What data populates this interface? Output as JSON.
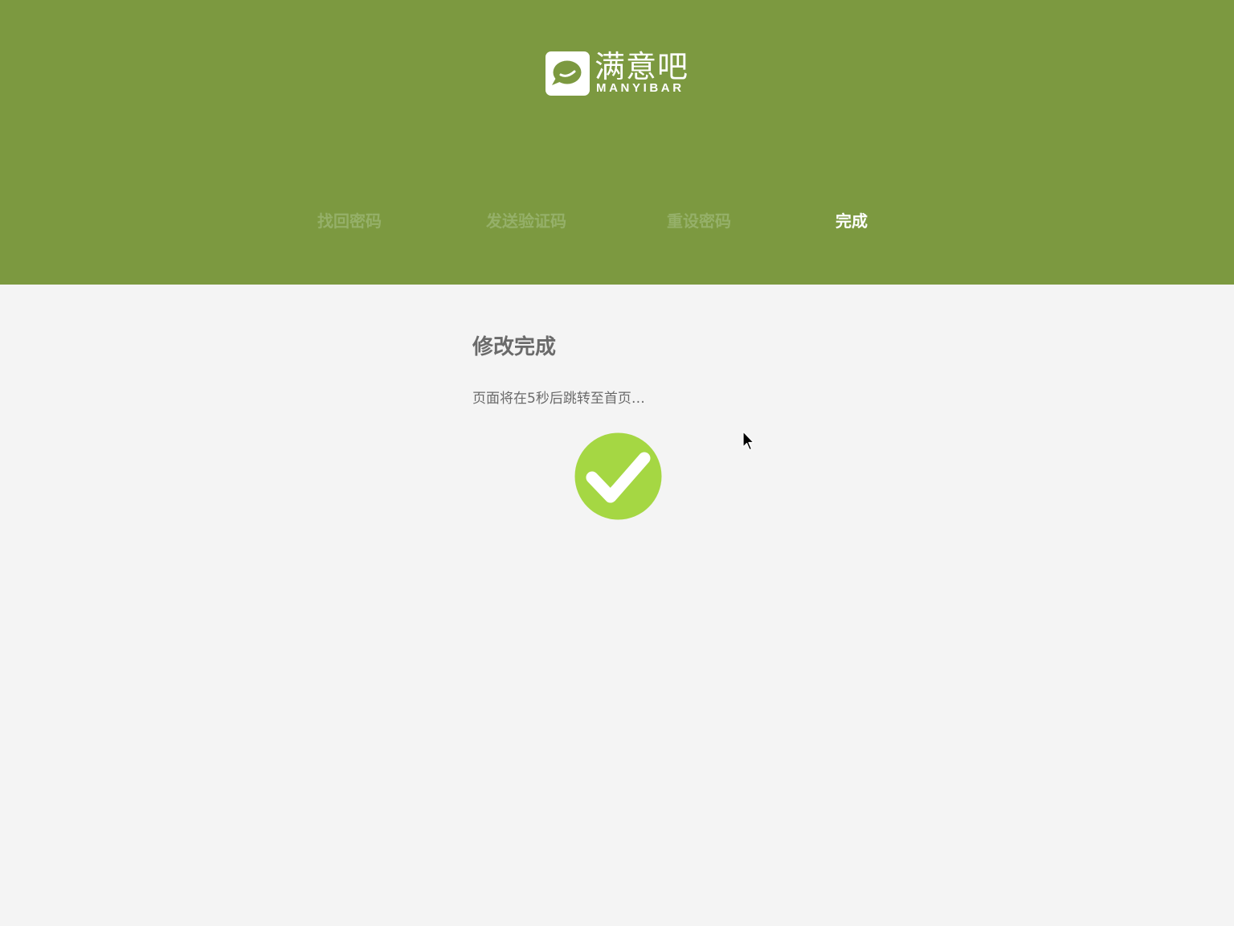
{
  "header": {
    "background_color": "#7c9940",
    "logo": {
      "name_cn": "满意吧",
      "name_en": "MANYIBAR",
      "icon": "chat-bubble-smile-icon"
    },
    "steps": [
      {
        "label": "找回密码",
        "state": "done"
      },
      {
        "label": "发送验证码",
        "state": "done"
      },
      {
        "label": "重设密码",
        "state": "done"
      },
      {
        "label": "完成",
        "state": "active"
      }
    ]
  },
  "main": {
    "title": "修改完成",
    "message": "页面将在5秒后跳转至首页…",
    "status_icon": "checkmark-circle-icon",
    "accent_color": "#a5d743"
  }
}
